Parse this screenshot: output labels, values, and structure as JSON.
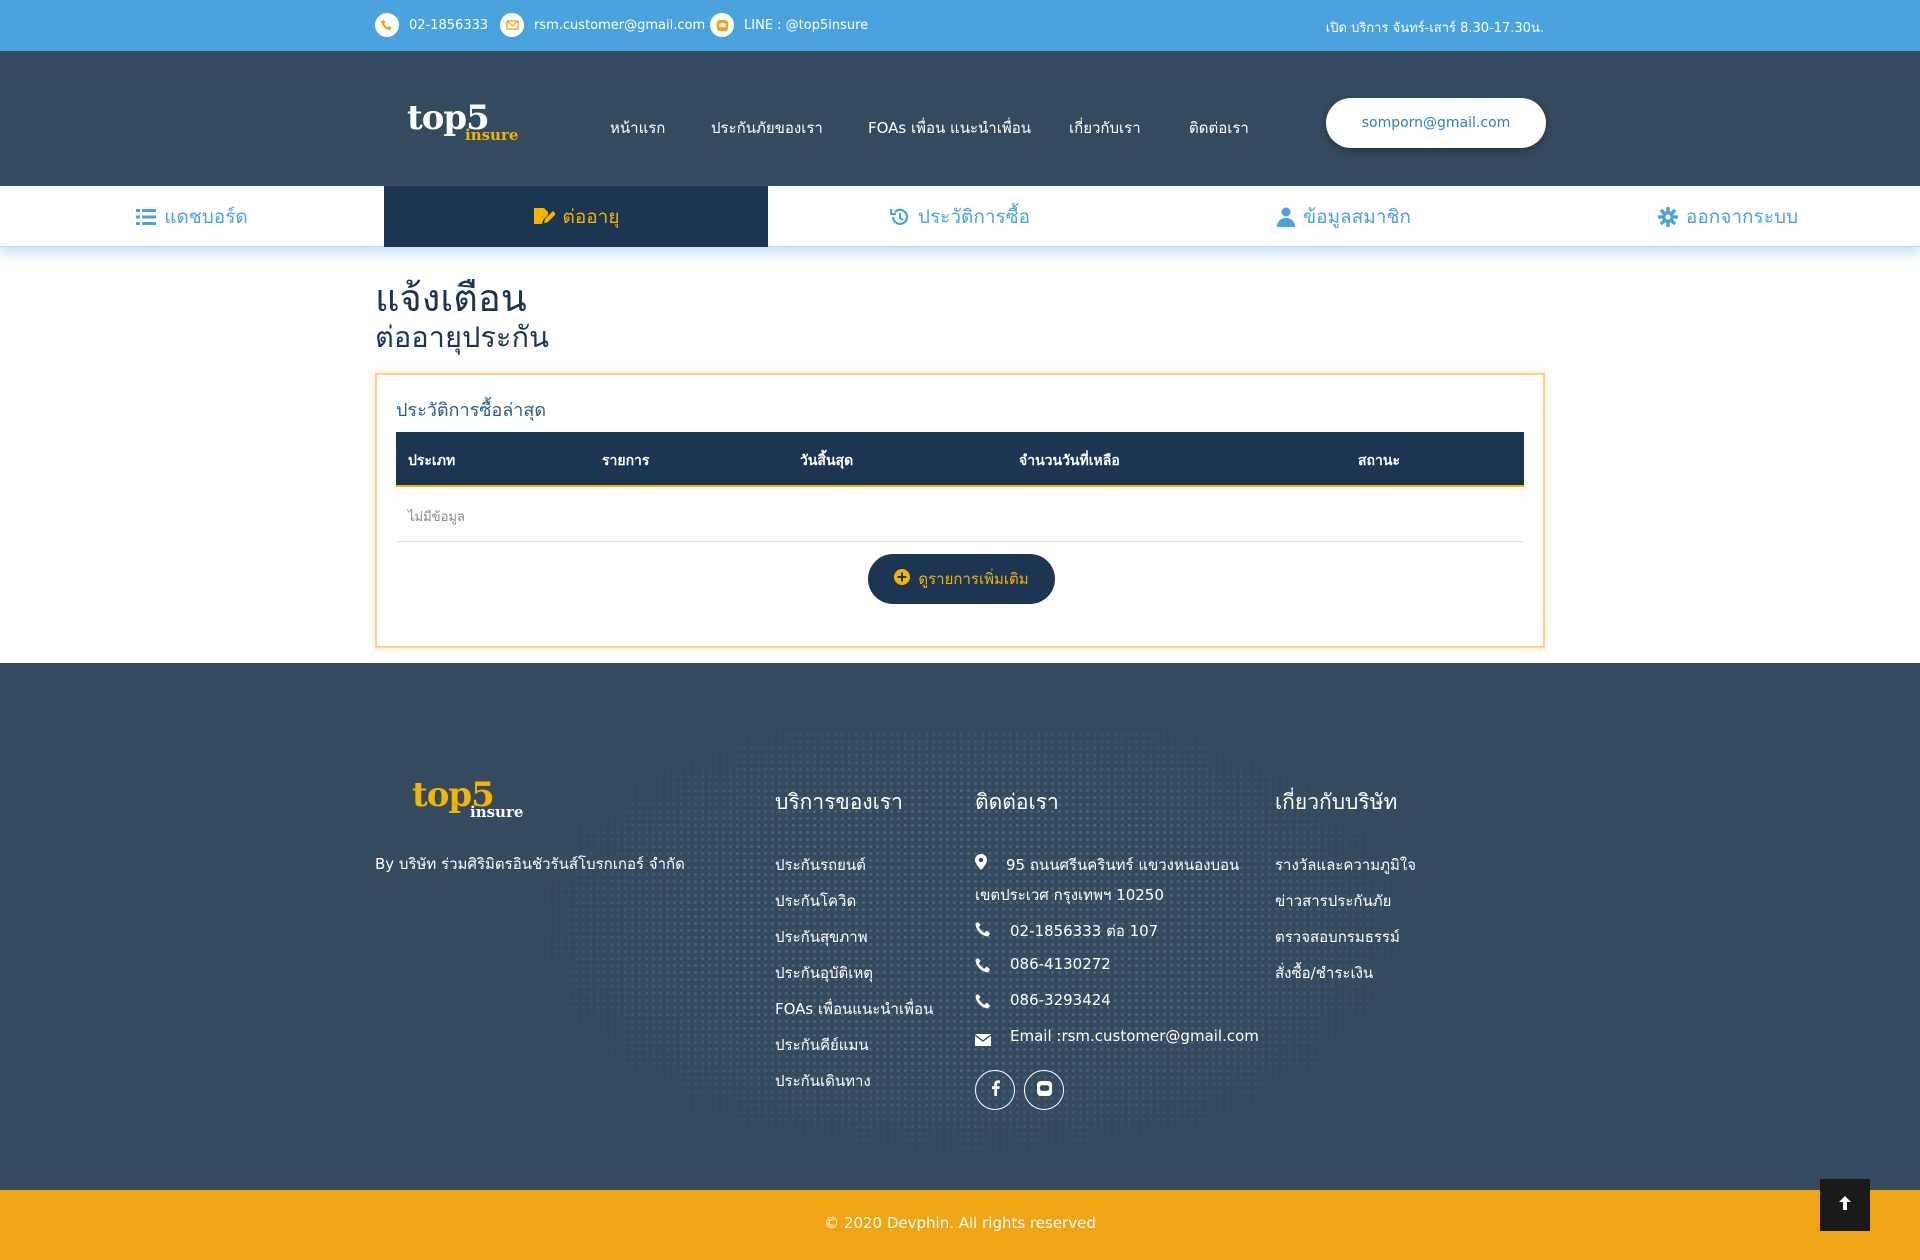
{
  "topbar": {
    "phone": "02-1856333",
    "email": "rsm.customer@gmail.com",
    "line": "LINE : @top5insure",
    "hours": "เปิด บริการ จันทร์-เสาร์ 8.30-17.30น."
  },
  "header": {
    "logo_top": "top5",
    "logo_bottom": "insure",
    "nav": [
      "หน้าแรก",
      "ประกันภัยของเรา",
      "FOAs เพื่อน แนะนำเพื่อน",
      "เกี่ยวกับเรา",
      "ติดต่อเรา"
    ],
    "user_email": "somporn@gmail.com"
  },
  "tabs": [
    {
      "label": "แดชบอร์ด",
      "icon": "list-icon",
      "active": false
    },
    {
      "label": "ต่ออายุ",
      "icon": "edit-icon",
      "active": true
    },
    {
      "label": "ประวัติการซื้อ",
      "icon": "history-icon",
      "active": false
    },
    {
      "label": "ข้อมูลสมาชิก",
      "icon": "user-icon",
      "active": false
    },
    {
      "label": "ออกจากระบบ",
      "icon": "gear-icon",
      "active": false
    }
  ],
  "main": {
    "title": "แจ้งเตือน",
    "subtitle": "ต่ออายุประกัน",
    "card_title": "ประวัติการซื้อล่าสุด",
    "columns": [
      "ประเภท",
      "รายการ",
      "วันสิ้นสุด",
      "จำนวนวันที่เหลือ",
      "สถานะ"
    ],
    "empty_text": "ไม่มีข้อมูล",
    "more_button": "ดูรายการเพิ่มเติม"
  },
  "footer": {
    "logo_top": "top5",
    "logo_bottom": "insure",
    "company": "By บริษัท ร่วมศิริมิตรอินชัวรันส์โบรกเกอร์ จำกัด",
    "services_title": "บริการของเรา",
    "services": [
      "ประกันรถยนต์",
      "ประกันโควิด",
      "ประกันสุขภาพ",
      "ประกันอุบัติเหตุ",
      "FOAs เพื่อนแนะนำเพื่อน",
      "ประกันคีย์แมน",
      "ประกันเดินทาง"
    ],
    "contact_title": "ติดต่อเรา",
    "address_line1": "95 ถนนศรีนครินทร์ แขวงหนองบอน",
    "address_line2": "เขตประเวศ กรุงเทพฯ 10250",
    "phones": [
      "02-1856333 ต่อ 107",
      "086-4130272",
      "086-3293424"
    ],
    "email": "Email :rsm.customer@gmail.com",
    "about_title": "เกี่ยวกับบริษัท",
    "about_links": [
      "รางวัลและความภูมิใจ",
      "ข่าวสารประกันภัย",
      "ตรวจสอบกรมธรรม์",
      "สั่งซื้อ/ชำระเงิน"
    ],
    "copyright": "© 2020 Devphin. All rights reserved"
  },
  "colors": {
    "topbar": "#4aa3dc",
    "header": "#344a5f",
    "navy": "#1c3553",
    "accent": "#f4b400",
    "footer_bottom": "#f0a514"
  }
}
